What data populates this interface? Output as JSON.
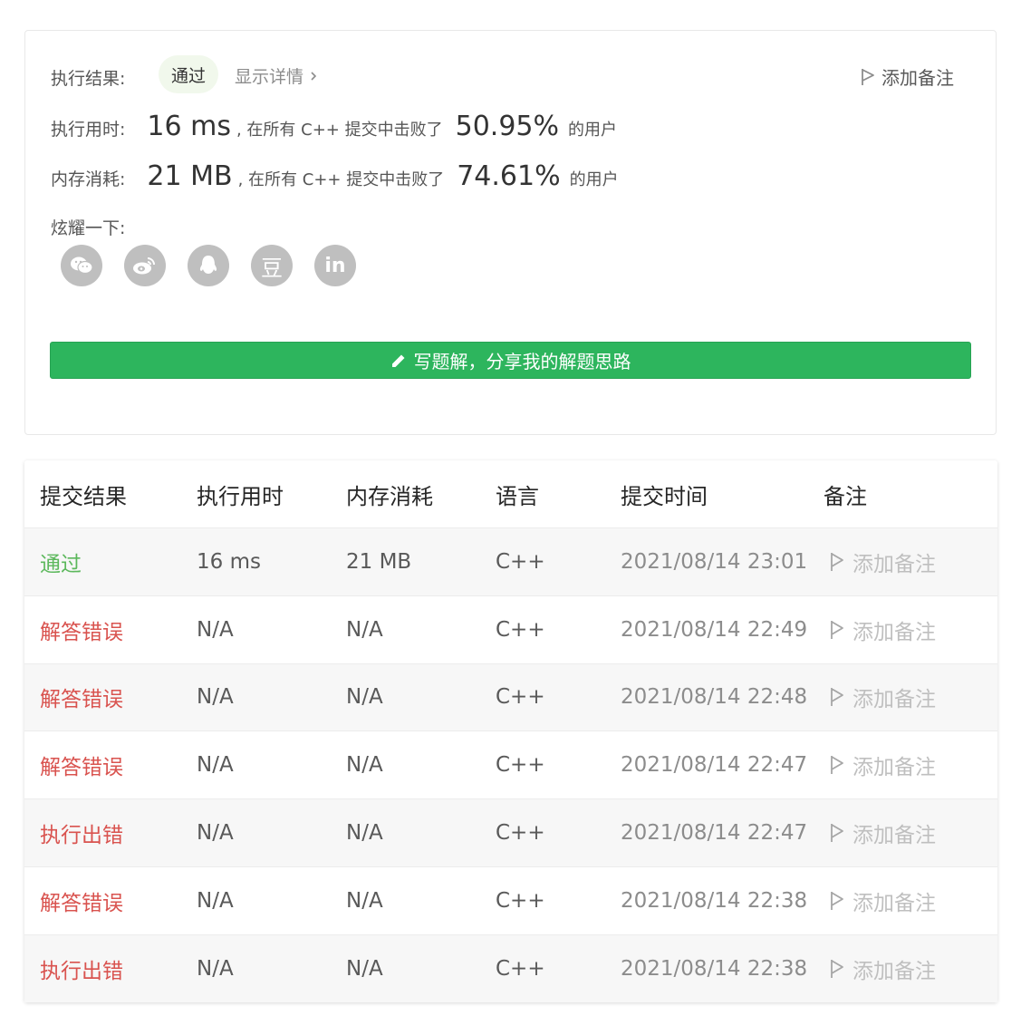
{
  "summary": {
    "result_label": "执行结果:",
    "result_value": "通过",
    "details_link": "显示详情",
    "add_note": "添加备注",
    "time_label": "执行用时:",
    "time_value": "16 ms",
    "time_mid": ", 在所有 C++ 提交中击败了",
    "time_pct": "50.95%",
    "time_tail": "的用户",
    "mem_label": "内存消耗:",
    "mem_value": "21 MB",
    "mem_mid": ", 在所有 C++ 提交中击败了",
    "mem_pct": "74.61%",
    "mem_tail": "的用户",
    "share_label": "炫耀一下:",
    "share_icons": [
      "wechat-icon",
      "weibo-icon",
      "qq-icon",
      "douban-icon",
      "linkedin-icon"
    ],
    "douban_glyph": "豆",
    "linkedin_glyph": "in",
    "write_button": "写题解，分享我的解题思路"
  },
  "table": {
    "headers": [
      "提交结果",
      "执行用时",
      "内存消耗",
      "语言",
      "提交时间",
      "备注"
    ],
    "rows": [
      {
        "status": "通过",
        "status_type": "ok",
        "time": "16 ms",
        "memory": "21 MB",
        "lang": "C++",
        "submitted": "2021/08/14 23:01",
        "note": "添加备注"
      },
      {
        "status": "解答错误",
        "status_type": "err",
        "time": "N/A",
        "memory": "N/A",
        "lang": "C++",
        "submitted": "2021/08/14 22:49",
        "note": "添加备注"
      },
      {
        "status": "解答错误",
        "status_type": "err",
        "time": "N/A",
        "memory": "N/A",
        "lang": "C++",
        "submitted": "2021/08/14 22:48",
        "note": "添加备注"
      },
      {
        "status": "解答错误",
        "status_type": "err",
        "time": "N/A",
        "memory": "N/A",
        "lang": "C++",
        "submitted": "2021/08/14 22:47",
        "note": "添加备注"
      },
      {
        "status": "执行出错",
        "status_type": "err",
        "time": "N/A",
        "memory": "N/A",
        "lang": "C++",
        "submitted": "2021/08/14 22:47",
        "note": "添加备注"
      },
      {
        "status": "解答错误",
        "status_type": "err",
        "time": "N/A",
        "memory": "N/A",
        "lang": "C++",
        "submitted": "2021/08/14 22:38",
        "note": "添加备注"
      },
      {
        "status": "执行出错",
        "status_type": "err",
        "time": "N/A",
        "memory": "N/A",
        "lang": "C++",
        "submitted": "2021/08/14 22:38",
        "note": "添加备注"
      }
    ]
  },
  "colors": {
    "accent_green": "#2db55d",
    "pass": "#5cb85c",
    "error": "#d9534f"
  }
}
